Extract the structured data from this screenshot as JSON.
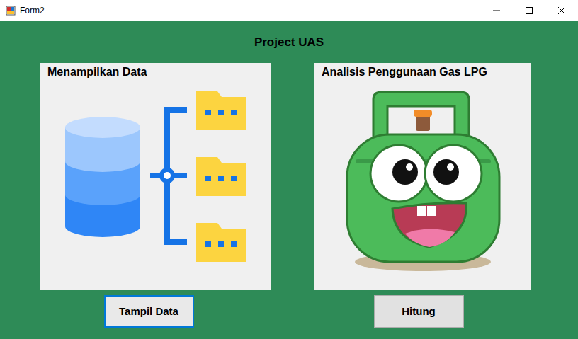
{
  "window": {
    "title": "Form2"
  },
  "heading": "Project UAS",
  "panels": [
    {
      "title": "Menampilkan Data",
      "kind": "database"
    },
    {
      "title": "Analisis Penggunaan Gas LPG",
      "kind": "lpg"
    }
  ],
  "buttons": [
    {
      "label": "Tampil Data",
      "focused": true
    },
    {
      "label": "Hitung",
      "focused": false
    }
  ]
}
